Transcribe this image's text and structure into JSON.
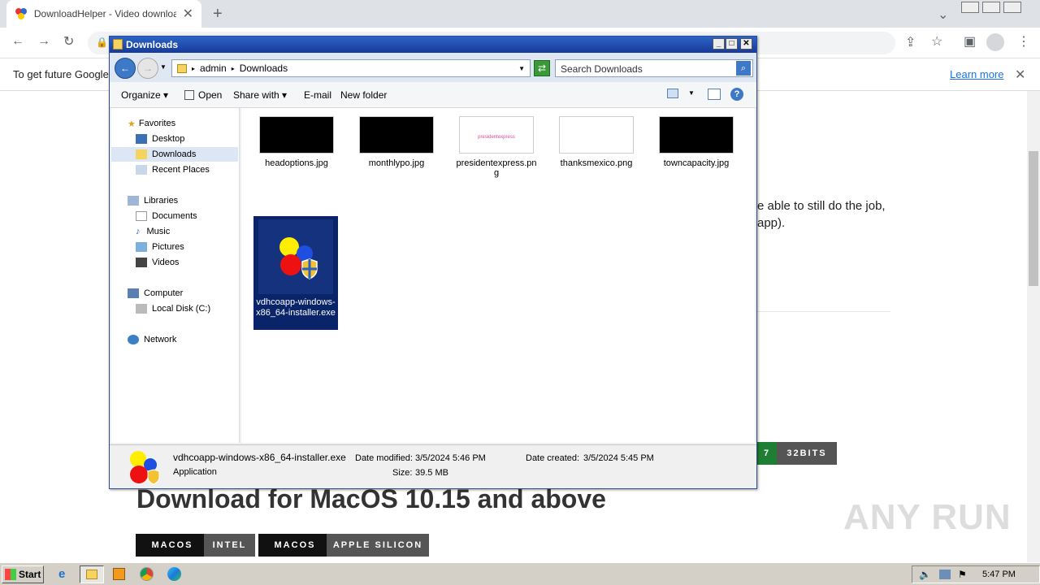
{
  "browser": {
    "tab_title": "DownloadHelper - Video download bro",
    "address": "",
    "infobar_text": "To get future Google",
    "infobar_link": "Learn more"
  },
  "page": {
    "text_line1": "e able to still do the job,",
    "text_line2": "app).",
    "win_btn_left": "7",
    "win_btn_right": "32BITS",
    "mac_heading": "Download for MacOS 10.15 and above",
    "mac_buttons": [
      {
        "left": "MACOS",
        "right": "INTEL"
      },
      {
        "left": "MACOS",
        "right": "APPLE SILICON"
      }
    ],
    "watermark": "ANY RUN"
  },
  "explorer": {
    "title": "Downloads",
    "breadcrumb": [
      "admin",
      "Downloads"
    ],
    "search_placeholder": "Search Downloads",
    "commands": {
      "organize": "Organize",
      "open": "Open",
      "share_with": "Share with",
      "email": "E-mail",
      "new_folder": "New folder"
    },
    "nav": {
      "favorites": "Favorites",
      "desktop": "Desktop",
      "downloads": "Downloads",
      "recent": "Recent Places",
      "libraries": "Libraries",
      "documents": "Documents",
      "music": "Music",
      "pictures": "Pictures",
      "videos": "Videos",
      "computer": "Computer",
      "local_disk": "Local Disk (C:)",
      "network": "Network"
    },
    "files": [
      {
        "name": "headoptions.jpg",
        "thumb_color": "#000000"
      },
      {
        "name": "monthlypo.jpg",
        "thumb_color": "#000000"
      },
      {
        "name": "presidentexpress.png",
        "thumb_color": "#ffffff",
        "thumb_text": "presidentexpress"
      },
      {
        "name": "thanksmexico.png",
        "thumb_color": "#ffffff"
      },
      {
        "name": "towncapacity.jpg",
        "thumb_color": "#000000"
      },
      {
        "name": "vdhcoapp-windows-x86_64-installer.exe",
        "selected": true
      }
    ],
    "details": {
      "filename": "vdhcoapp-windows-x86_64-installer.exe",
      "type": "Application",
      "modified_label": "Date modified:",
      "modified_value": "3/5/2024 5:46 PM",
      "size_label": "Size:",
      "size_value": "39.5 MB",
      "created_label": "Date created:",
      "created_value": "3/5/2024 5:45 PM"
    }
  },
  "taskbar": {
    "start": "Start",
    "clock": "5:47 PM"
  }
}
